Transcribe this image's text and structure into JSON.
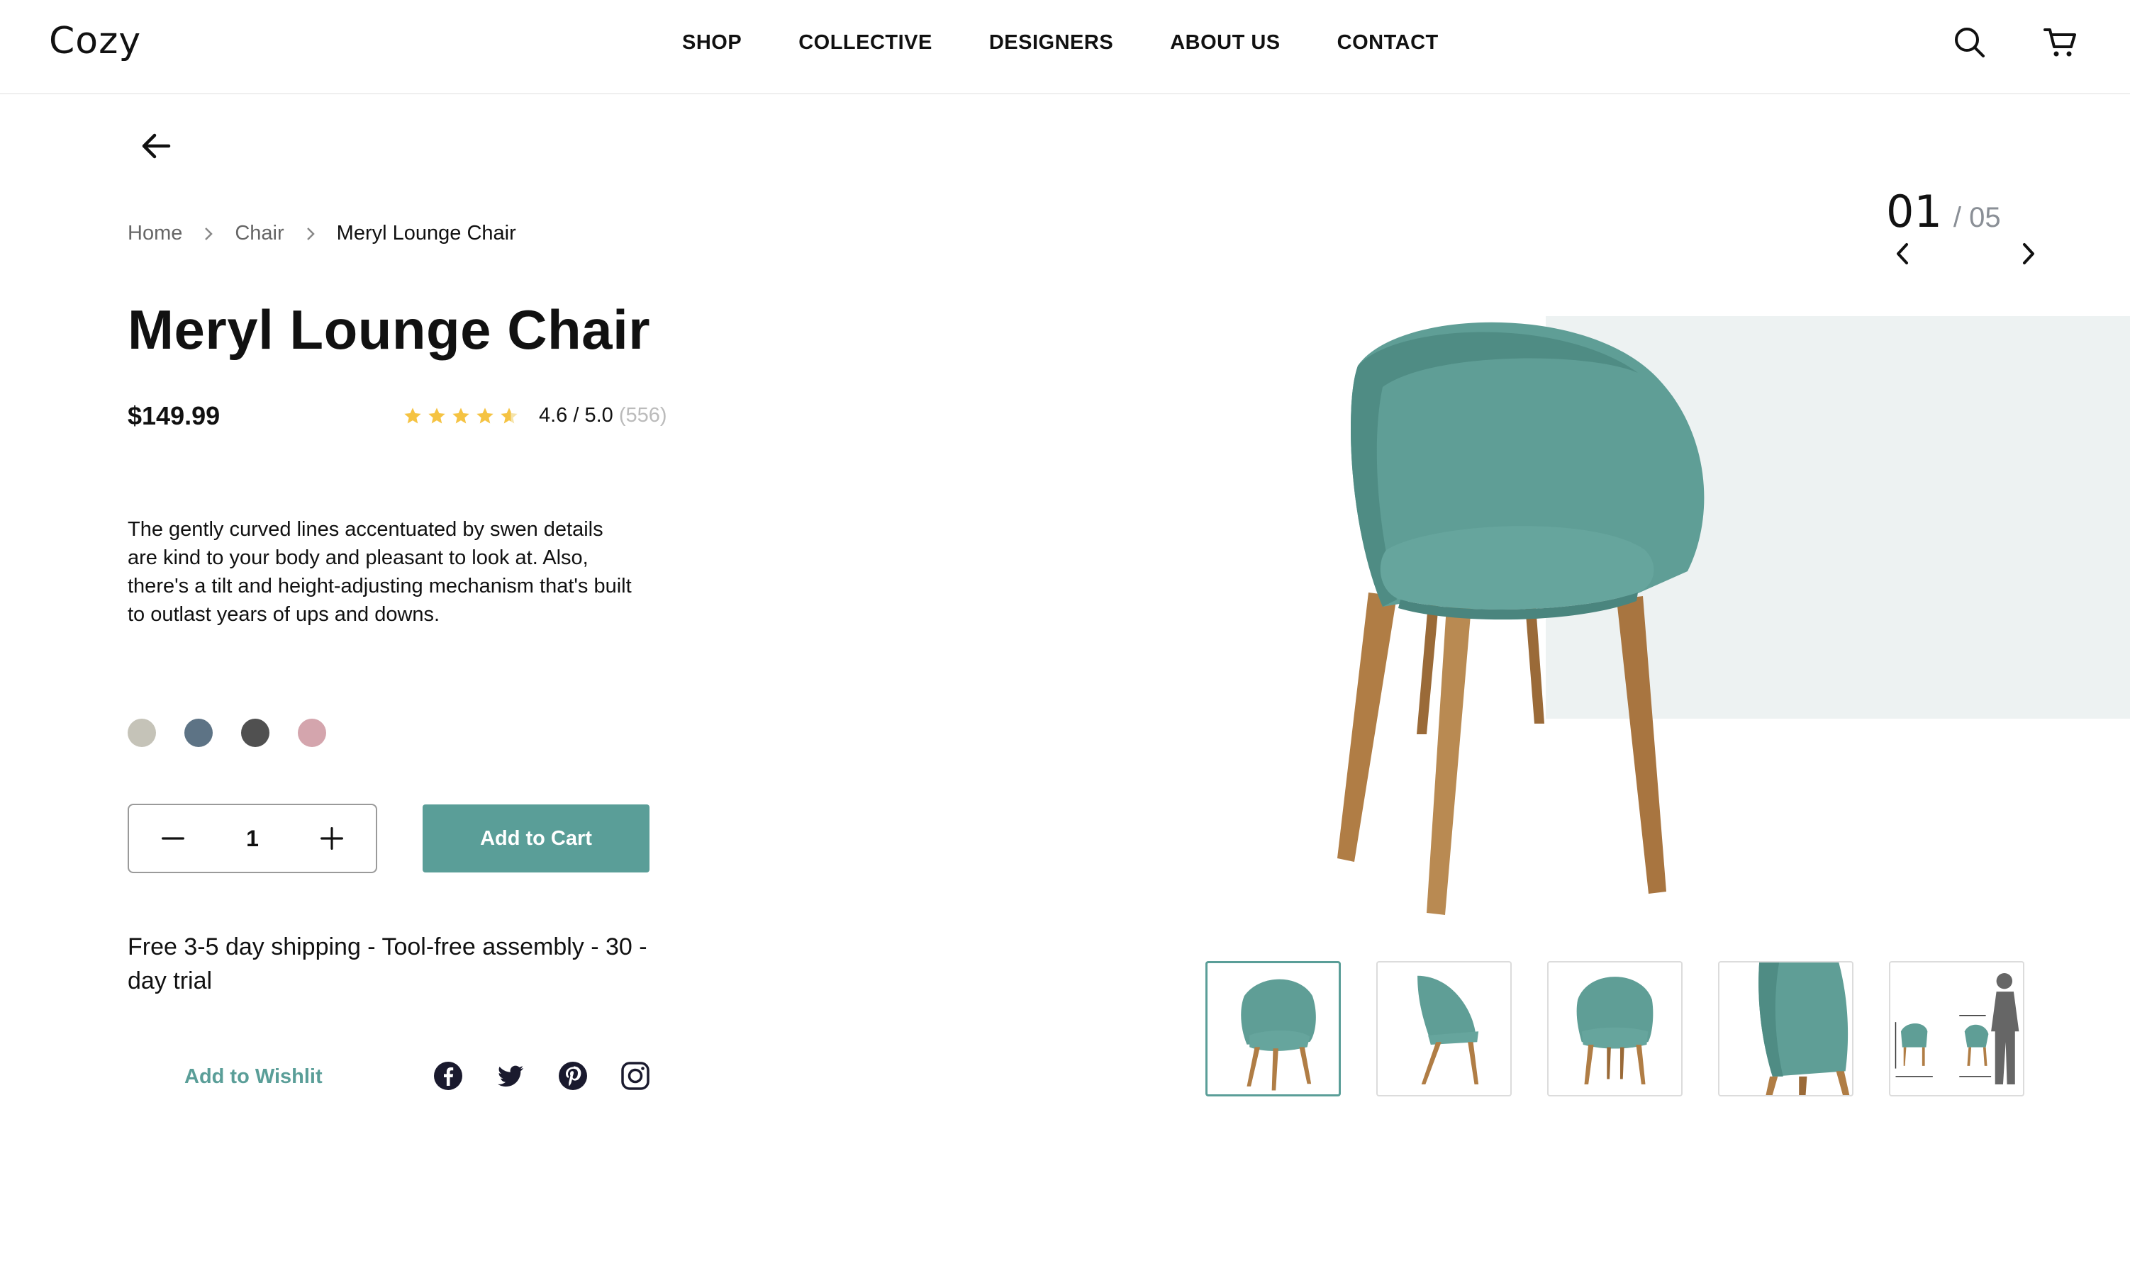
{
  "header": {
    "logo": "Cozy",
    "nav": [
      "SHOP",
      "COLLECTIVE",
      "DESIGNERS",
      "ABOUT US",
      "CONTACT"
    ],
    "icons": [
      "search-icon",
      "cart-icon"
    ]
  },
  "breadcrumb": {
    "items": [
      "Home",
      "Chair",
      "Meryl Lounge Chair"
    ]
  },
  "product": {
    "title": "Meryl Lounge Chair",
    "price": "$149.99",
    "rating_value": 4.6,
    "rating_text": "4.6 / 5.0",
    "rating_count": "(556)",
    "description": "The gently curved lines accentuated by swen details are kind to your body and pleasant to look at. Also, there's a tilt and height-adjusting mechanism that's built to outlast years of ups and downs.",
    "swatches": [
      "#c5c3b8",
      "#5d7385",
      "#505050",
      "#d4a5ad"
    ],
    "quantity": "1",
    "add_to_cart": "Add to Cart",
    "shipping": "Free 3-5 day shipping - Tool-free assembly - 30 - day trial",
    "wishlist": "Add to Wishlit",
    "social": [
      "facebook-icon",
      "twitter-icon",
      "pinterest-icon",
      "instagram-icon"
    ]
  },
  "gallery": {
    "current": "01",
    "total": "/ 05",
    "thumbnails": 5,
    "active_index": 0
  },
  "colors": {
    "accent": "#5a9e98",
    "star": "#f5c342",
    "chair": "#5f9e96",
    "wood": "#b07d45"
  }
}
